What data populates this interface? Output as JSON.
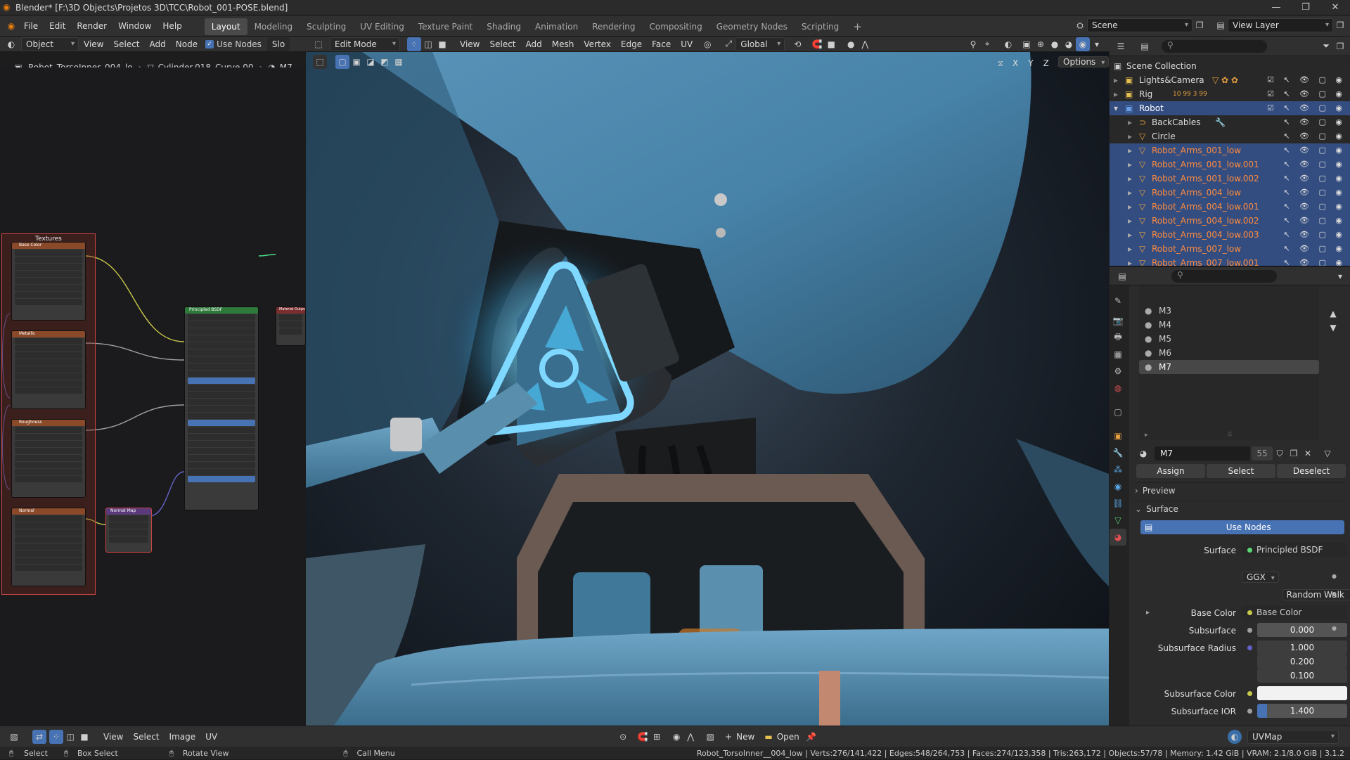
{
  "titlebar": {
    "title": "Blender* [F:\\3D Objects\\Projetos 3D\\TCC\\Robot_001-POSE.blend]"
  },
  "menubar": {
    "items": [
      "File",
      "Edit",
      "Render",
      "Window",
      "Help"
    ]
  },
  "workspaces": [
    "Layout",
    "Modeling",
    "Sculpting",
    "UV Editing",
    "Texture Paint",
    "Shading",
    "Animation",
    "Rendering",
    "Compositing",
    "Geometry Nodes",
    "Scripting"
  ],
  "active_workspace": "Layout",
  "scene": {
    "name": "Scene",
    "view_layer": "View Layer"
  },
  "node_editor": {
    "mode": "Object",
    "menus": [
      "View",
      "Select",
      "Add",
      "Node"
    ],
    "use_nodes": "Use Nodes",
    "slot_trunc": "Slo",
    "breadcrumb": [
      "Robot_TorsoInner_004_lo",
      "Cylinder.018_Curve.00",
      "M7"
    ],
    "frame_label": "Textures",
    "tex_nodes": [
      "Base Color",
      "Metallic",
      "Roughness",
      "Normal"
    ],
    "normal_map": "Normal Map",
    "bsdf": "Principled BSDF",
    "output": "Material Output"
  },
  "viewport": {
    "mode": "Edit Mode",
    "menus": [
      "View",
      "Select",
      "Add",
      "Mesh",
      "Vertex",
      "Edge",
      "Face",
      "UV"
    ],
    "transform": "Global",
    "options": "Options",
    "axes": [
      "X",
      "Y",
      "Z"
    ]
  },
  "outliner": {
    "root": "Scene Collection",
    "rows": [
      {
        "label": "Lights&Camera",
        "indent": 0,
        "type": "collection"
      },
      {
        "label": "Rig",
        "indent": 0,
        "type": "collection"
      },
      {
        "label": "Robot",
        "indent": 0,
        "type": "collection",
        "selected": true
      },
      {
        "label": "BackCables",
        "indent": 1,
        "type": "object"
      },
      {
        "label": "Circle",
        "indent": 1,
        "type": "object"
      },
      {
        "label": "Robot_Arms_001_low",
        "indent": 1,
        "type": "mesh",
        "selected": true
      },
      {
        "label": "Robot_Arms_001_low.001",
        "indent": 1,
        "type": "mesh",
        "selected": true
      },
      {
        "label": "Robot_Arms_001_low.002",
        "indent": 1,
        "type": "mesh",
        "selected": true
      },
      {
        "label": "Robot_Arms_004_low",
        "indent": 1,
        "type": "mesh",
        "selected": true
      },
      {
        "label": "Robot_Arms_004_low.001",
        "indent": 1,
        "type": "mesh",
        "selected": true
      },
      {
        "label": "Robot_Arms_004_low.002",
        "indent": 1,
        "type": "mesh",
        "selected": true
      },
      {
        "label": "Robot_Arms_004_low.003",
        "indent": 1,
        "type": "mesh",
        "selected": true
      },
      {
        "label": "Robot_Arms_007_low",
        "indent": 1,
        "type": "mesh",
        "selected": true
      },
      {
        "label": "Robot_Arms_007_low.001",
        "indent": 1,
        "type": "mesh",
        "selected": true
      }
    ],
    "rig_badges": "10 99 3 99"
  },
  "materials": {
    "list": [
      "M3",
      "M4",
      "M5",
      "M6",
      "M7"
    ],
    "active": "M7",
    "name": "M7",
    "users": "55",
    "buttons": {
      "assign": "Assign",
      "select": "Select",
      "deselect": "Deselect"
    }
  },
  "surface": {
    "preview": "Preview",
    "surface": "Surface",
    "use_nodes": "Use Nodes",
    "surface_label": "Surface",
    "surface_value": "Principled BSDF",
    "distribution": "GGX",
    "subsurface_method": "Random Walk",
    "base_color_label": "Base Color",
    "base_color_value": "Base Color",
    "subsurface_label": "Subsurface",
    "subsurface_value": "0.000",
    "radius_label": "Subsurface Radius",
    "radius_values": [
      "1.000",
      "0.200",
      "0.100"
    ],
    "sub_color_label": "Subsurface Color",
    "sub_ior_label": "Subsurface IOR",
    "sub_ior_value": "1.400"
  },
  "uv_header": {
    "menus": [
      "View",
      "Select",
      "Image",
      "UV"
    ],
    "new": "New",
    "open": "Open",
    "uvmap": "UVMap"
  },
  "statusbar": {
    "select": "Select",
    "box_select": "Box Select",
    "rotate": "Rotate View",
    "call_menu": "Call Menu",
    "stats": "Robot_TorsoInner__004_low | Verts:276/141,422 | Edges:548/264,753 | Faces:274/123,358 | Tris:263,172 | Objects:57/78 | Memory: 1.42 GiB | VRAM: 2.1/8.0 GiB | 3.1.2"
  },
  "colors": {
    "accent": "#4772b3",
    "selected_row": "#334d80",
    "orange_text": "#ff8b3d",
    "glow": "#7fd8ff"
  }
}
